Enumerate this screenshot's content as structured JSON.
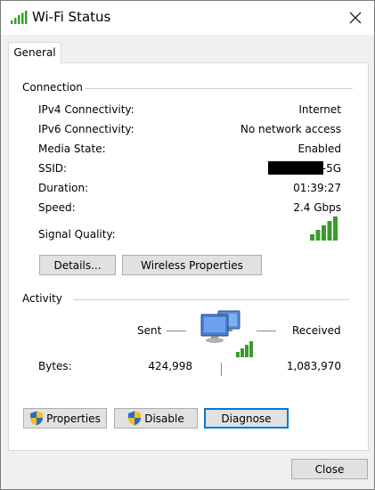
{
  "window": {
    "title": "Wi-Fi Status",
    "tab": "General"
  },
  "connection": {
    "header": "Connection",
    "rows": [
      {
        "label": "IPv4 Connectivity:",
        "value": "Internet"
      },
      {
        "label": "IPv6 Connectivity:",
        "value": "No network access"
      },
      {
        "label": "Media State:",
        "value": "Enabled"
      },
      {
        "label": "SSID:",
        "value": "-5G"
      },
      {
        "label": "Duration:",
        "value": "01:39:27"
      },
      {
        "label": "Speed:",
        "value": "2.4 Gbps"
      }
    ],
    "signal_label": "Signal Quality:",
    "signal_bars": 5,
    "signal_max": 5,
    "details_button": "Details...",
    "wireless_button": "Wireless Properties"
  },
  "activity": {
    "header": "Activity",
    "sent_label": "Sent",
    "received_label": "Received",
    "bytes_label": "Bytes:",
    "bytes_sent": "424,998",
    "bytes_received": "1,083,970"
  },
  "buttons": {
    "properties": "Properties",
    "disable": "Disable",
    "diagnose": "Diagnose",
    "close": "Close"
  },
  "colors": {
    "signal": "#3c9a2e",
    "focus": "#0078d7",
    "shield_blue": "#2a6cc4",
    "shield_yellow": "#f2c21b"
  },
  "icons": [
    "wifi-signal-icon",
    "close-icon",
    "network-computers-icon",
    "uac-shield-icon"
  ]
}
